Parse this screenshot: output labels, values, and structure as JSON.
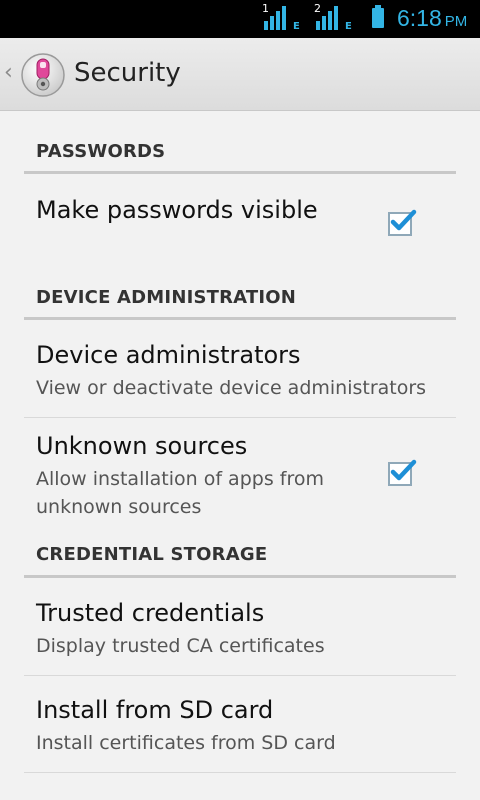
{
  "status_bar": {
    "sim1_label": "1",
    "sim1_net": "E",
    "sim2_label": "2",
    "sim2_net": "E",
    "time": "6:18",
    "ampm": "PM"
  },
  "action_bar": {
    "title": "Security",
    "icon": "security-lock-icon"
  },
  "sections": {
    "passwords": {
      "header": "PASSWORDS",
      "items": [
        {
          "title": "Make passwords visible",
          "checked": true
        }
      ]
    },
    "device_admin": {
      "header": "DEVICE ADMINISTRATION",
      "items": [
        {
          "title": "Device administrators",
          "subtitle": "View or deactivate device administrators"
        },
        {
          "title": "Unknown sources",
          "subtitle": "Allow installation of apps from unknown sources",
          "checked": true
        }
      ]
    },
    "credential_storage": {
      "header": "CREDENTIAL STORAGE",
      "items": [
        {
          "title": "Trusted credentials",
          "subtitle": "Display trusted CA certificates"
        },
        {
          "title": "Install from SD card",
          "subtitle": "Install certificates from SD card"
        }
      ]
    }
  },
  "colors": {
    "accent": "#33b5e5",
    "check": "#1e8fd6",
    "background": "#f2f2f2"
  }
}
